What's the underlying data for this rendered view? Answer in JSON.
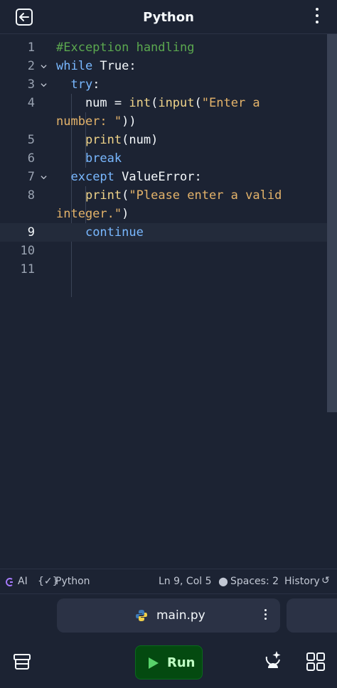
{
  "header": {
    "title": "Python",
    "back_icon": "exit-icon",
    "menu_icon": "kebab-icon"
  },
  "editor": {
    "lines": [
      {
        "num": "1",
        "fold": false,
        "tokens": [
          {
            "t": "#Exception handling",
            "c": "cmt"
          }
        ]
      },
      {
        "num": "2",
        "fold": true,
        "tokens": [
          {
            "t": "while",
            "c": "kw"
          },
          {
            "t": " True:",
            "c": ""
          }
        ]
      },
      {
        "num": "3",
        "fold": true,
        "tokens": [
          {
            "t": "  ",
            "c": ""
          },
          {
            "t": "try",
            "c": "kw"
          },
          {
            "t": ":",
            "c": ""
          }
        ]
      },
      {
        "num": "4",
        "fold": false,
        "tokens": [
          {
            "t": "    num = ",
            "c": ""
          },
          {
            "t": "int",
            "c": "fn"
          },
          {
            "t": "(",
            "c": ""
          },
          {
            "t": "input",
            "c": "fn"
          },
          {
            "t": "(",
            "c": ""
          },
          {
            "t": "\"Enter a",
            "c": "str"
          }
        ]
      },
      {
        "num": "",
        "fold": false,
        "tokens": [
          {
            "t": "number: \"",
            "c": "str"
          },
          {
            "t": "))",
            "c": ""
          }
        ]
      },
      {
        "num": "5",
        "fold": false,
        "tokens": [
          {
            "t": "    ",
            "c": ""
          },
          {
            "t": "print",
            "c": "fn"
          },
          {
            "t": "(num)",
            "c": ""
          }
        ]
      },
      {
        "num": "6",
        "fold": false,
        "tokens": [
          {
            "t": "    ",
            "c": ""
          },
          {
            "t": "break",
            "c": "kw"
          }
        ]
      },
      {
        "num": "7",
        "fold": true,
        "tokens": [
          {
            "t": "  ",
            "c": ""
          },
          {
            "t": "except",
            "c": "kw"
          },
          {
            "t": " ValueError:",
            "c": ""
          }
        ]
      },
      {
        "num": "8",
        "fold": false,
        "tokens": [
          {
            "t": "    ",
            "c": ""
          },
          {
            "t": "print",
            "c": "fn"
          },
          {
            "t": "(",
            "c": ""
          },
          {
            "t": "\"Please enter a valid",
            "c": "str"
          }
        ]
      },
      {
        "num": "",
        "fold": false,
        "tokens": [
          {
            "t": "integer.\"",
            "c": "str"
          },
          {
            "t": ")",
            "c": ""
          }
        ]
      },
      {
        "num": "9",
        "fold": false,
        "active": true,
        "tokens": [
          {
            "t": "    ",
            "c": ""
          },
          {
            "t": "continue",
            "c": "kw"
          }
        ]
      },
      {
        "num": "10",
        "fold": false,
        "tokens": []
      },
      {
        "num": "11",
        "fold": false,
        "tokens": []
      }
    ]
  },
  "status": {
    "ai_label": "AI",
    "language_label": "Python",
    "cursor": "Ln 9, Col 5",
    "spaces": "Spaces: 2",
    "history": "History"
  },
  "tabs": {
    "active_file": "main.py"
  },
  "bottom": {
    "run_label": "Run"
  },
  "colors": {
    "background": "#1c2333",
    "comment": "#5ba84f",
    "keyword": "#79b8ff",
    "function": "#f0d48a",
    "string": "#e4b36a",
    "run_button": "#044a10"
  }
}
